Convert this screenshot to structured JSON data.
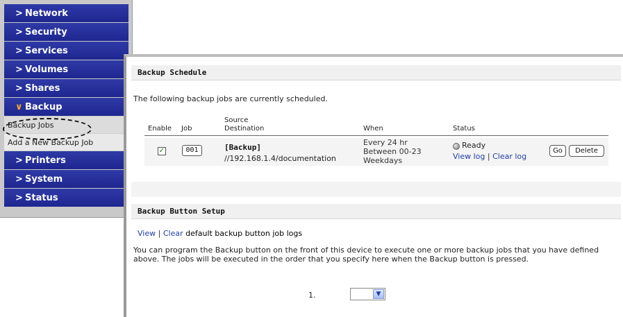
{
  "sidebar": {
    "items": [
      {
        "label": "Network"
      },
      {
        "label": "Security"
      },
      {
        "label": "Services"
      },
      {
        "label": "Volumes"
      },
      {
        "label": "Shares"
      },
      {
        "label": "Backup"
      },
      {
        "label": "Printers"
      },
      {
        "label": "System"
      },
      {
        "label": "Status"
      }
    ],
    "backup_sub": [
      {
        "label": "Backup Jobs"
      },
      {
        "label": "Add a New Backup Job"
      }
    ],
    "colors": {
      "menu_bg": "#2a34a0",
      "open_arrow": "#f6a623"
    }
  },
  "schedule": {
    "title": "Backup Schedule",
    "intro": "The following backup jobs are currently scheduled.",
    "columns": {
      "enable": "Enable",
      "job": "Job",
      "source": "Source",
      "destination": "Destination",
      "when": "When",
      "status": "Status"
    },
    "row": {
      "enabled": true,
      "job": "001",
      "source": "[Backup]",
      "destination": "//192.168.1.4/documentation",
      "when": [
        "Every 24 hr",
        "Between 00-23",
        "Weekdays"
      ],
      "status": "Ready",
      "view_log": "View log",
      "sep": "|",
      "clear_log": "Clear log",
      "go": "Go",
      "delete": "Delete"
    }
  },
  "button_setup": {
    "title": "Backup Button Setup",
    "view": "View",
    "sep": "|",
    "clear": "Clear",
    "logs_text": "default backup button job logs",
    "description": "You can program the Backup button on the front of this device to execute one or more backup jobs that you have defined above. The jobs will be executed in the order that you specify here when the Backup button is pressed.",
    "order_label": "1.",
    "select_value": ""
  }
}
